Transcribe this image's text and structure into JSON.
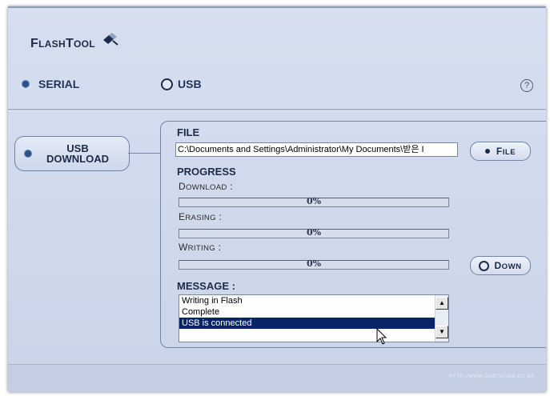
{
  "app": {
    "title_prefix": "Flash",
    "title_suffix": "Tool"
  },
  "tabs": {
    "serial_label": "SERIAL",
    "usb_label": "USB",
    "help": "?"
  },
  "sidebar": {
    "usb_download_line1": "USB",
    "usb_download_line2": "DOWNLOAD"
  },
  "file": {
    "title": "FILE",
    "path": "C:\\Documents and Settings\\Administrator\\My Documents\\받은 I",
    "button_label": "File"
  },
  "progress": {
    "title": "PROGRESS",
    "download_label": "Download :",
    "download_value": "0%",
    "download_fraction": 0,
    "erasing_label": "Erasing :",
    "erasing_value": "0%",
    "erasing_fraction": 0,
    "writing_label": "Writing :",
    "writing_value": "0%",
    "writing_fraction": 0,
    "down_button_label": "Down"
  },
  "message": {
    "title": "MESSAGE :",
    "items": [
      "Writing in Flash",
      "Complete",
      "USB is connected"
    ],
    "selected_index": 2
  },
  "footer": {
    "url": "HTTP://WWW.DOSTATION.CO.KR"
  },
  "colors": {
    "background": "#d6dff0",
    "accent": "#1c2b4a",
    "selection": "#0a246a"
  }
}
